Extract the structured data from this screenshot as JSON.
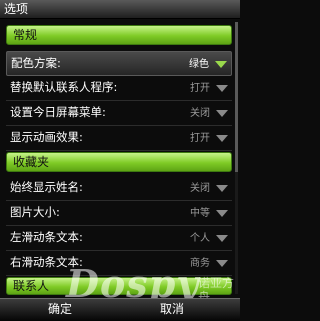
{
  "title": "选项",
  "sections": {
    "general": "常规",
    "favorites": "收藏夹",
    "contacts_partial": "联系人"
  },
  "rows": [
    {
      "label": "配色方案:",
      "value": "绿色"
    },
    {
      "label": "替换默认联系人程序:",
      "value": "打开"
    },
    {
      "label": "设置今日屏幕菜单:",
      "value": "关闭"
    },
    {
      "label": "显示动画效果:",
      "value": "打开"
    },
    {
      "label": "始终显示姓名:",
      "value": "关闭"
    },
    {
      "label": "图片大小:",
      "value": "中等"
    },
    {
      "label": "左滑动条文本:",
      "value": "个人"
    },
    {
      "label": "右滑动条文本:",
      "value": "商务"
    }
  ],
  "softkeys": {
    "left": "确定",
    "right": "取消"
  },
  "watermark": {
    "brand": "Dospy",
    "site": "诺亚方舟"
  },
  "colors": {
    "accent": "#7fcb26",
    "selected_arrow": "#9ad94c"
  }
}
